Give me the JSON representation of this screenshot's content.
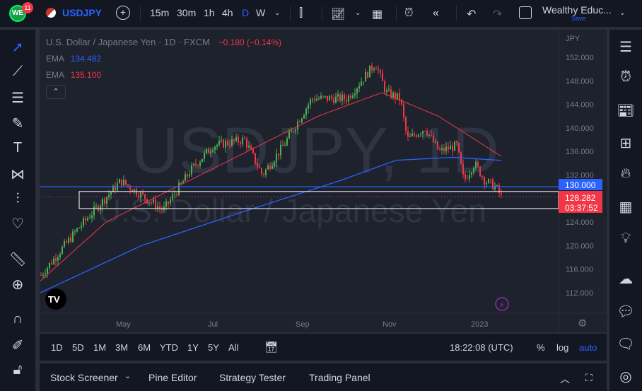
{
  "topbar": {
    "badge": "11",
    "logo": "WE",
    "symbol": "USDJPY",
    "timeframes": [
      "15m",
      "30m",
      "1h",
      "4h",
      "D",
      "W"
    ],
    "active_tf": "D",
    "layout_name": "Wealthy Educ...",
    "save": "Save"
  },
  "legend": {
    "title": "U.S. Dollar / Japanese Yen · 1D · FXCM",
    "change": "−0.180 (−0.14%)",
    "ema1_label": "EMA",
    "ema1_value": "134.482",
    "ema2_label": "EMA",
    "ema2_value": "135.100"
  },
  "watermark": {
    "symbol": "USDJPY, 1D",
    "name": "U.S. Dollar / Japanese Yen"
  },
  "price_axis": {
    "currency": "JPY",
    "ticks": [
      "152.000",
      "148.000",
      "144.000",
      "140.000",
      "136.000",
      "132.000",
      "124.000",
      "120.000",
      "116.000",
      "112.000"
    ],
    "line_label": "130.000",
    "last_price": "128.282",
    "countdown": "03:37:52"
  },
  "time_axis": {
    "labels": [
      "May",
      "Jul",
      "Sep",
      "Nov",
      "2023"
    ]
  },
  "ranges": {
    "items": [
      "1D",
      "5D",
      "1M",
      "3M",
      "6M",
      "YTD",
      "1Y",
      "5Y",
      "All"
    ],
    "clock": "18:22:08 (UTC)",
    "percent": "%",
    "log": "log",
    "auto": "auto"
  },
  "bottom": {
    "tabs": [
      "Stock Screener",
      "Pine Editor",
      "Strategy Tester",
      "Trading Panel"
    ]
  },
  "colors": {
    "up": "#26a69a",
    "green": "#4caf50",
    "down": "#f23645",
    "ema_blue": "#2962ff",
    "ema_red": "#f23645",
    "accent": "#2962ff"
  },
  "chart_data": {
    "type": "candlestick",
    "symbol": "USDJPY",
    "ylim": [
      110,
      154
    ],
    "price_path": [
      [
        0,
        115
      ],
      [
        53,
        123
      ],
      [
        113,
        131
      ],
      [
        173,
        126
      ],
      [
        213,
        133
      ],
      [
        243,
        137
      ],
      [
        288,
        138
      ],
      [
        313,
        132
      ],
      [
        343,
        137
      ],
      [
        383,
        145
      ],
      [
        433,
        145
      ],
      [
        473,
        151
      ],
      [
        488,
        146
      ],
      [
        508,
        145
      ],
      [
        518,
        138
      ],
      [
        543,
        140
      ],
      [
        563,
        136
      ],
      [
        588,
        137
      ],
      [
        598,
        131
      ],
      [
        613,
        134
      ],
      [
        628,
        131
      ],
      [
        643,
        130
      ],
      [
        651,
        128.28
      ]
    ],
    "ema_red": [
      [
        0,
        114
      ],
      [
        93,
        124
      ],
      [
        193,
        130
      ],
      [
        293,
        136
      ],
      [
        393,
        142
      ],
      [
        483,
        146
      ],
      [
        563,
        142
      ],
      [
        653,
        135.1
      ]
    ],
    "ema_blue": [
      [
        0,
        112
      ],
      [
        143,
        120
      ],
      [
        293,
        126
      ],
      [
        423,
        131
      ],
      [
        503,
        134.5
      ],
      [
        583,
        135
      ],
      [
        653,
        134.48
      ]
    ],
    "hline": 130,
    "zone": [
      126.3,
      129.2
    ]
  }
}
